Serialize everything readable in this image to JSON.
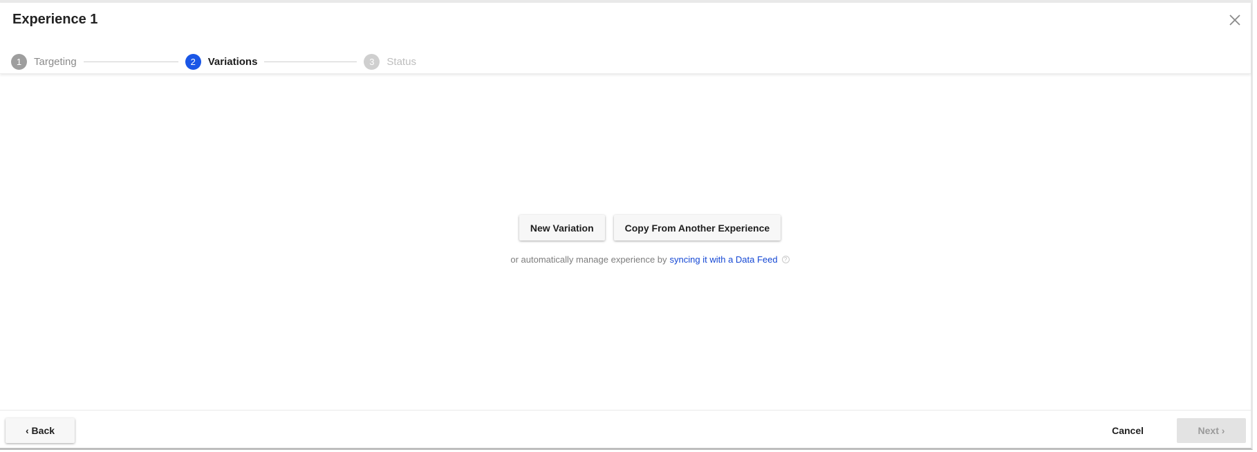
{
  "header": {
    "title": "Experience 1",
    "close_icon": "close-icon"
  },
  "stepper": {
    "steps": [
      {
        "number": "1",
        "label": "Targeting",
        "state": "completed"
      },
      {
        "number": "2",
        "label": "Variations",
        "state": "active"
      },
      {
        "number": "3",
        "label": "Status",
        "state": "upcoming"
      }
    ]
  },
  "main": {
    "new_variation_label": "New Variation",
    "copy_label": "Copy From Another Experience",
    "hint_prefix": "or automatically manage experience by",
    "hint_link": "syncing it with a Data Feed",
    "info_icon": "info-icon"
  },
  "footer": {
    "back_label": "Back",
    "cancel_label": "Cancel",
    "next_label": "Next",
    "back_icon": "chevron-left-icon",
    "next_icon": "chevron-right-icon"
  },
  "colors": {
    "active_step": "#1a56e6",
    "link": "#1447d4"
  }
}
